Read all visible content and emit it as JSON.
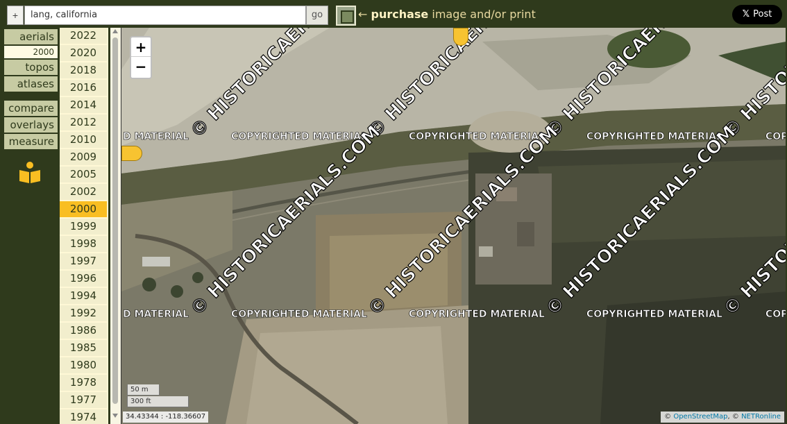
{
  "topbar": {
    "plus_label": "+",
    "search_value": "lang, california",
    "go_label": "go",
    "purchase_arrow": "←",
    "purchase_bold": "purchase",
    "purchase_rest": "image and/or print",
    "post_logo": "𝕏",
    "post_label": "Post"
  },
  "nav": {
    "aerials": "aerials",
    "aerials_year": "2000",
    "topos": "topos",
    "atlases": "atlases",
    "compare": "compare",
    "overlays": "overlays",
    "measure": "measure"
  },
  "years": [
    "2022",
    "2020",
    "2018",
    "2016",
    "2014",
    "2012",
    "2010",
    "2009",
    "2005",
    "2002",
    "2000",
    "1999",
    "1998",
    "1997",
    "1996",
    "1994",
    "1992",
    "1986",
    "1985",
    "1980",
    "1978",
    "1977",
    "1974"
  ],
  "selected_year": "2000",
  "map": {
    "zoom_in": "+",
    "zoom_out": "−",
    "scale_metric": "50 m",
    "scale_imperial": "300 ft",
    "coordinates": "34.43344 : -118.36607",
    "attribution_prefix": "©",
    "attribution_osm": "OpenStreetMap",
    "attribution_sep": ", ©",
    "attribution_net": "NETRonline",
    "watermark_site": "© HISTORICAERIALS.COM",
    "watermark_copyright": "COPYRIGHTED MATERIAL"
  },
  "colors": {
    "background": "#2f3a1c",
    "nav_tab": "#c7cba3",
    "year_bg": "#f2eecd",
    "year_selected": "#f9be22",
    "accent_text": "#e8d9a0"
  }
}
